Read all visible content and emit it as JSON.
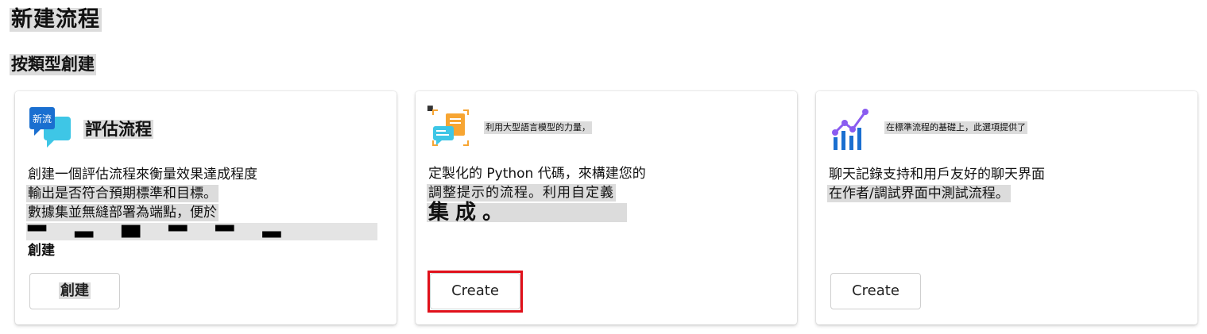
{
  "page": {
    "title": "新建流程",
    "section_title": "按類型創建"
  },
  "cards": [
    {
      "icon": "chat-bubbles-icon",
      "icon_badge_text": "新流",
      "title": "評估流程",
      "description_lines": [
        "創建一個評估流程來衡量效果達成程度",
        "輸出是否符合預期標準和目標。",
        "數據集並無縫部署為端點，便於",
        "創建"
      ],
      "button_label": "創建"
    },
    {
      "icon": "document-chat-icon",
      "title": "利用大型語言模型的力量，",
      "description_lines": [
        "定製化的 Python 代碼，來構建您的",
        "調整提示的流程。利用自定義",
        "集成。"
      ],
      "button_label": "Create"
    },
    {
      "icon": "bar-line-chart-icon",
      "title": "在標準流程的基礎上，此選項提供了",
      "description_lines": [
        "聊天記錄支持和用戶友好的聊天界面",
        "在作者/調試界面中測試流程。"
      ],
      "button_label": "Create"
    }
  ],
  "colors": {
    "highlight": "#dcdcdc",
    "focus_outline": "#e0101a",
    "icon_blue": "#1a6fd0",
    "icon_cyan": "#3ec6e6",
    "icon_orange": "#f7a532",
    "icon_purple": "#8a5cf0"
  }
}
